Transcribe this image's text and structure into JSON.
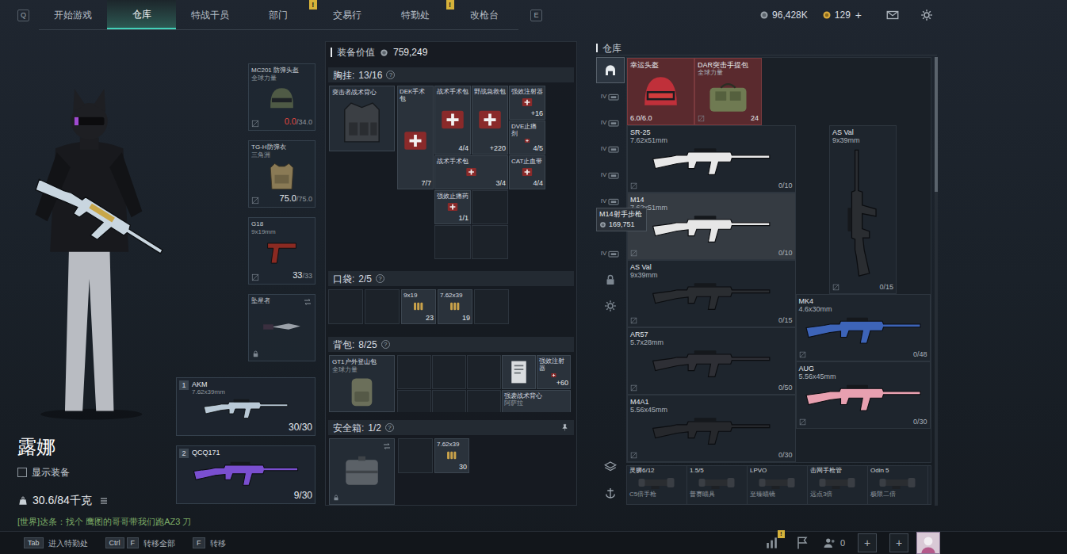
{
  "nav": {
    "left_key": "Q",
    "right_key": "E",
    "tabs": [
      {
        "label": "开始游戏",
        "selected": false
      },
      {
        "label": "仓库",
        "selected": true
      },
      {
        "label": "特战干员",
        "selected": false
      },
      {
        "label": "部门",
        "selected": false,
        "badge": "!"
      },
      {
        "label": "交易行",
        "selected": false
      },
      {
        "label": "特勤处",
        "selected": false,
        "badge": "!"
      },
      {
        "label": "改枪台",
        "selected": false
      }
    ],
    "coins": "96,428K",
    "tickets": "129",
    "add": "+"
  },
  "operator": {
    "name": "露娜",
    "show_gear": {
      "label": "显示装备",
      "checked": false
    },
    "weight": "30.6/84千克",
    "chat": "[世界]达条：找个 鹰图的哥哥带我们跑AZ3 刀"
  },
  "gear": [
    {
      "kind": "helmet",
      "name": "MC201 防弹头盔",
      "sub": "全球力量",
      "value": "0.0",
      "max": "/34.0",
      "broken": true
    },
    {
      "kind": "armor",
      "name": "TG-H防弹衣",
      "sub": "三角洲",
      "value": "75.0",
      "max": "/75.0",
      "broken": false
    },
    {
      "kind": "pistol",
      "name": "G18",
      "sub": "9x19mm",
      "value": "33",
      "max": "/33",
      "broken": false
    },
    {
      "kind": "melee",
      "name": "坠星者",
      "locked": true
    }
  ],
  "weapons": [
    {
      "slot": "1",
      "name": "AKM",
      "caliber": "7.62x39mm",
      "ammo": "30/30",
      "color": "#b9c9d6"
    },
    {
      "slot": "2",
      "name": "QCQ171",
      "ammo": "9/30",
      "color": "#7a4fd0"
    }
  ],
  "loadout": {
    "value_label": "装备价值",
    "value": "759,249",
    "sections": [
      {
        "kind": "rig",
        "title": "胸挂:",
        "count": "13/16",
        "help": "?",
        "carrier": {
          "name": "突击者战术背心"
        },
        "items": [
          {
            "label": "DEK手术包",
            "count": "7/7"
          },
          {
            "label": "战术手术包",
            "count": "4/4"
          },
          {
            "label": "野战急救包",
            "count": "+220"
          },
          {
            "label": "强效注射器",
            "count": "+16"
          },
          {
            "label": "DVE止痛剂",
            "count": "4/5"
          },
          {
            "label": "战术手术包",
            "count": "3/4"
          },
          {
            "label": "CAT止血带",
            "count": "4/4"
          },
          {
            "label": "强效止痛药",
            "count": "1/1"
          }
        ]
      },
      {
        "kind": "pockets",
        "title": "口袋:",
        "count": "2/5",
        "help": "?",
        "slots": [
          {
            "empty": true
          },
          {
            "empty": true
          },
          {
            "empty": false,
            "label": "9x19",
            "count": "23"
          },
          {
            "empty": false,
            "label": "7.62x39",
            "count": "19"
          },
          {
            "empty": true
          }
        ]
      },
      {
        "kind": "bag",
        "title": "背包:",
        "count": "8/25",
        "help": "?",
        "carrier": {
          "name": "GT1户外登山包",
          "sub": "全球力量"
        },
        "items": [
          {
            "kind": "doc"
          },
          {
            "kind": "med",
            "label": "强效注射器",
            "count": "+60"
          },
          {
            "kind": "vest",
            "label": "强袭战术背心",
            "sub": "阿萨拉"
          }
        ]
      },
      {
        "kind": "case",
        "title": "安全箱:",
        "count": "1/2",
        "help": "?",
        "pinned": true,
        "slots": [
          {
            "empty": true
          },
          {
            "empty": false,
            "label": "7.62x39",
            "count": "30"
          }
        ]
      }
    ]
  },
  "warehouse": {
    "title": "仓库",
    "sidebar": [
      {
        "kind": "home",
        "selected": true
      },
      {
        "kind": "tier",
        "label": "IV",
        "selected": false
      },
      {
        "kind": "tier",
        "label": "IV",
        "selected": false
      },
      {
        "kind": "tier",
        "label": "IV",
        "selected": false
      },
      {
        "kind": "tier",
        "label": "IV",
        "selected": false
      },
      {
        "kind": "tier",
        "label": "IV",
        "selected": false
      },
      {
        "kind": "tier",
        "label": "IV",
        "selected": false
      },
      {
        "kind": "tier",
        "label": "IV",
        "selected": false
      },
      {
        "kind": "lock",
        "selected": false
      },
      {
        "kind": "gear",
        "selected": false
      },
      {
        "kind": "layers",
        "selected": false
      },
      {
        "kind": "anchor",
        "selected": false
      }
    ],
    "items": [
      {
        "kind": "helmet",
        "name": "幸运头盔",
        "durability": "6.0/6.0",
        "tier": "red",
        "hovered": false,
        "color": "#c0303a"
      },
      {
        "kind": "bag",
        "name": "DAR突击手提包",
        "sub": "全球力量",
        "count": "24",
        "tier": "red",
        "hovered": false,
        "color": "#6f7a52"
      },
      {
        "kind": "gun",
        "name": "SR-25",
        "caliber": "7.62x51mm",
        "ammo": "0/10",
        "tier": "none",
        "hovered": false,
        "color": "#e8e8e8"
      },
      {
        "kind": "gun-vertical",
        "name": "AS Val",
        "caliber": "9x39mm",
        "ammo": "0/15",
        "tier": "none",
        "hovered": false,
        "color": "#2a2d31"
      },
      {
        "kind": "gun",
        "name": "M14",
        "caliber": "7.62x51mm",
        "ammo": "0/10",
        "tier": "none",
        "hovered": true,
        "color": "#e6e6e6"
      },
      {
        "kind": "gun",
        "name": "AS Val",
        "caliber": "9x39mm",
        "ammo": "0/15",
        "tier": "none",
        "hovered": false,
        "color": "#2a2d31"
      },
      {
        "kind": "gun",
        "name": "MK4",
        "caliber": "4.6x30mm",
        "ammo": "0/48",
        "tier": "none",
        "hovered": false,
        "color": "#3d64b8"
      },
      {
        "kind": "gun",
        "name": "AR57",
        "caliber": "5.7x28mm",
        "ammo": "0/50",
        "tier": "none",
        "hovered": false,
        "color": "#2e2f35"
      },
      {
        "kind": "gun",
        "name": "AUG",
        "caliber": "5.56x45mm",
        "ammo": "0/30",
        "tier": "none",
        "hovered": false,
        "color": "#e8a0b0"
      },
      {
        "kind": "gun",
        "name": "M4A1",
        "caliber": "5.56x45mm",
        "ammo": "0/30",
        "tier": "none",
        "hovered": false,
        "color": "#26282c"
      }
    ],
    "tooltip": {
      "title": "M14射手步枪",
      "price": "169,751"
    },
    "attachments": [
      {
        "name": "灵狮6/12",
        "sub": "C5倍手枪"
      },
      {
        "name": "1.5/5",
        "sub": "普赛瞄具"
      },
      {
        "name": "LPVO",
        "sub": "至臻瞄镜"
      },
      {
        "name": "击网手枪管",
        "sub": "远点3倍"
      },
      {
        "name": "Odin 5",
        "sub": "极限二倍"
      }
    ]
  },
  "footer": {
    "hints": [
      {
        "keys": [
          "Tab"
        ],
        "label": "进入特勤处"
      },
      {
        "keys": [
          "Ctrl",
          "F"
        ],
        "label": "转移全部"
      },
      {
        "keys": [
          "F"
        ],
        "label": "转移"
      }
    ],
    "stats_badge": "!",
    "friends": "0",
    "add": [
      "+",
      "+"
    ]
  }
}
